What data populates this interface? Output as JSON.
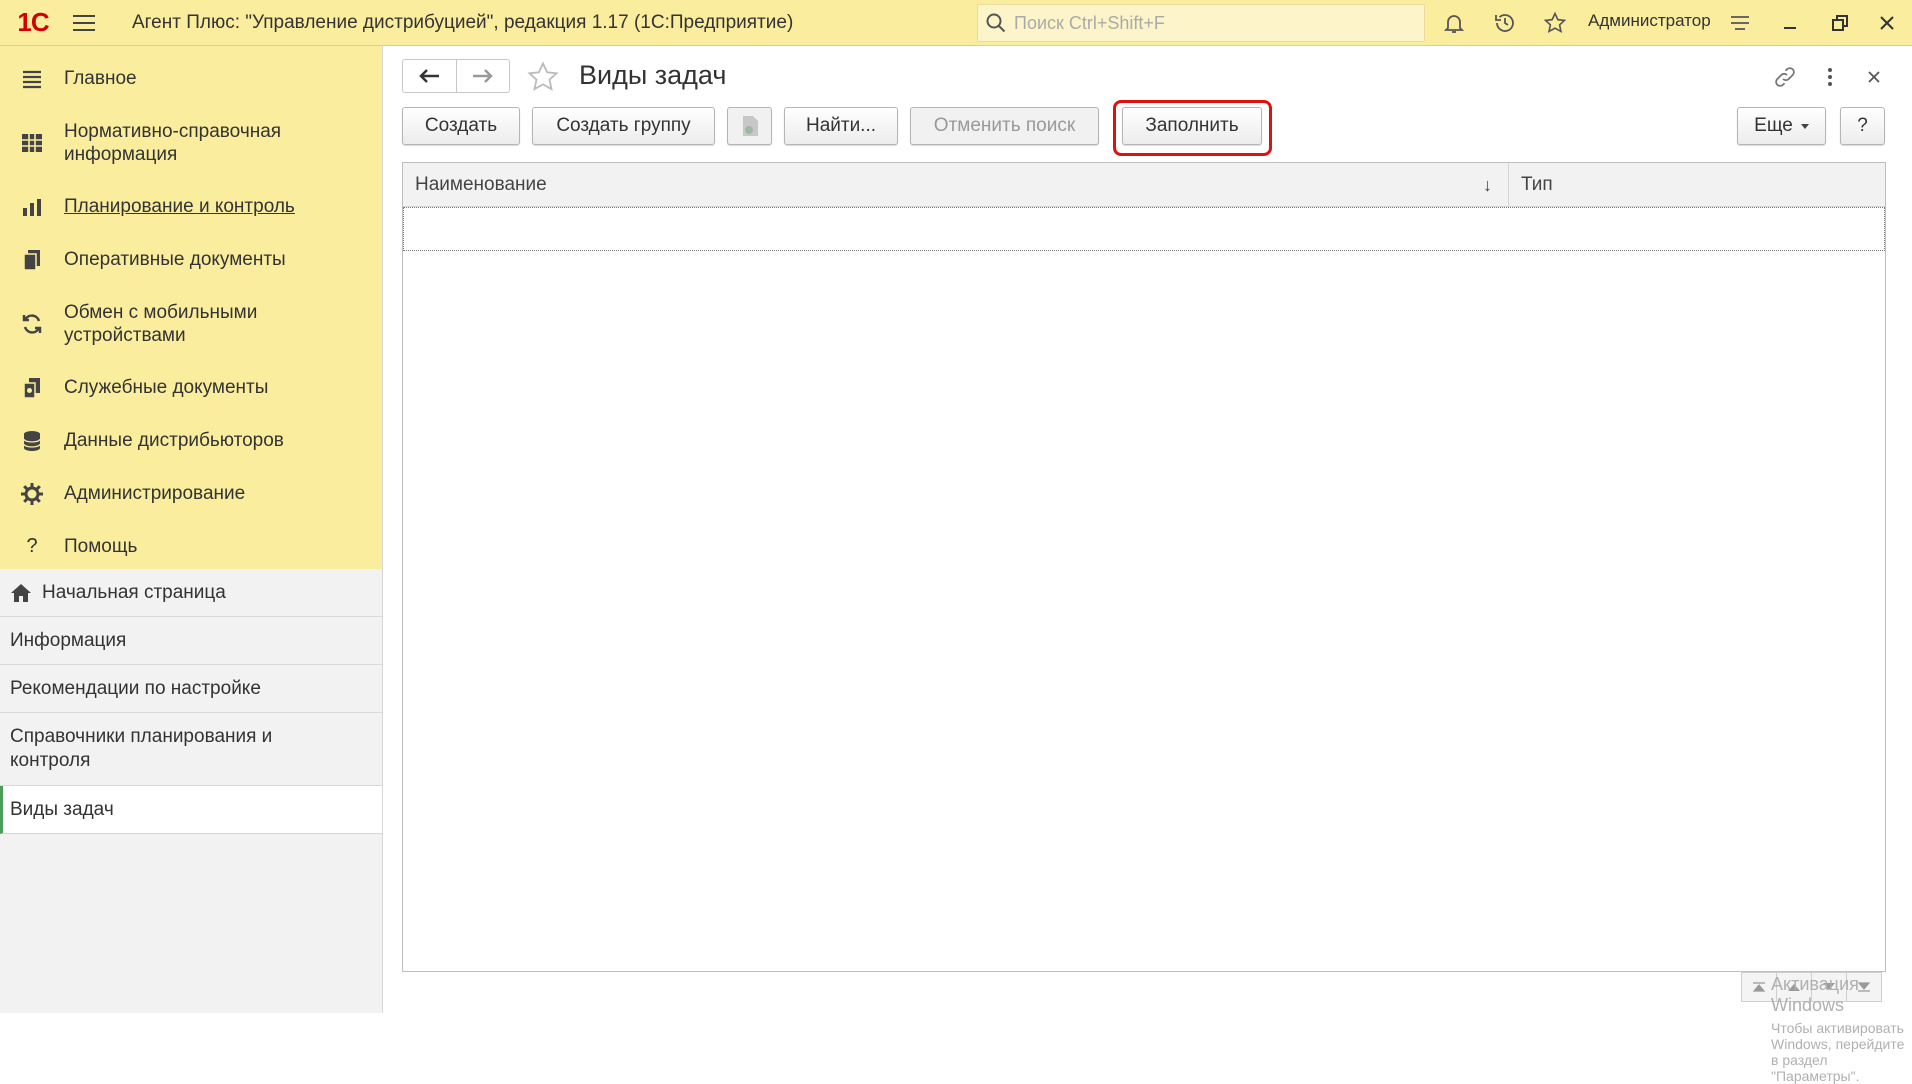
{
  "app": {
    "logo": "1С",
    "title": "Агент Плюс: \"Управление дистрибуцией\", редакция 1.17  (1С:Предприятие)",
    "search_placeholder": "Поиск Ctrl+Shift+F",
    "user": "Администратор",
    "accent_color": "#fbed9e"
  },
  "sidebar": {
    "sections": [
      {
        "label": "Главное",
        "icon": "menu-lines-icon"
      },
      {
        "label": "Нормативно-справочная информация",
        "icon": "grid-icon"
      },
      {
        "label": "Планирование и контроль",
        "icon": "bar-chart-icon"
      },
      {
        "label": "Оперативные документы",
        "icon": "documents-icon"
      },
      {
        "label": "Обмен с мобильными устройствами",
        "icon": "sync-icon"
      },
      {
        "label": "Служебные документы",
        "icon": "service-docs-icon"
      },
      {
        "label": "Данные дистрибьюторов",
        "icon": "database-icon"
      },
      {
        "label": "Администрирование",
        "icon": "gear-icon"
      },
      {
        "label": "Помощь",
        "icon": "help-icon"
      }
    ],
    "open_windows": [
      {
        "label": "Начальная страница"
      },
      {
        "label": "Информация"
      },
      {
        "label": "Рекомендации по настройке"
      },
      {
        "label": "Справочники планирования и контроля"
      },
      {
        "label": "Виды задач"
      }
    ]
  },
  "main": {
    "title": "Виды задач",
    "toolbar": {
      "create": "Создать",
      "create_group": "Создать группу",
      "find": "Найти...",
      "cancel_search": "Отменить поиск",
      "fill": "Заполнить",
      "more": "Еще",
      "help": "?"
    },
    "table": {
      "columns": [
        "Наименование",
        "Тип"
      ],
      "sort_indicator": "↓",
      "rows": []
    },
    "watermark": {
      "line1": "Активация Windows",
      "line2": "Чтобы активировать Windows, перейдите в раздел \"Параметры\"."
    },
    "highlight_color": "#e01010"
  }
}
